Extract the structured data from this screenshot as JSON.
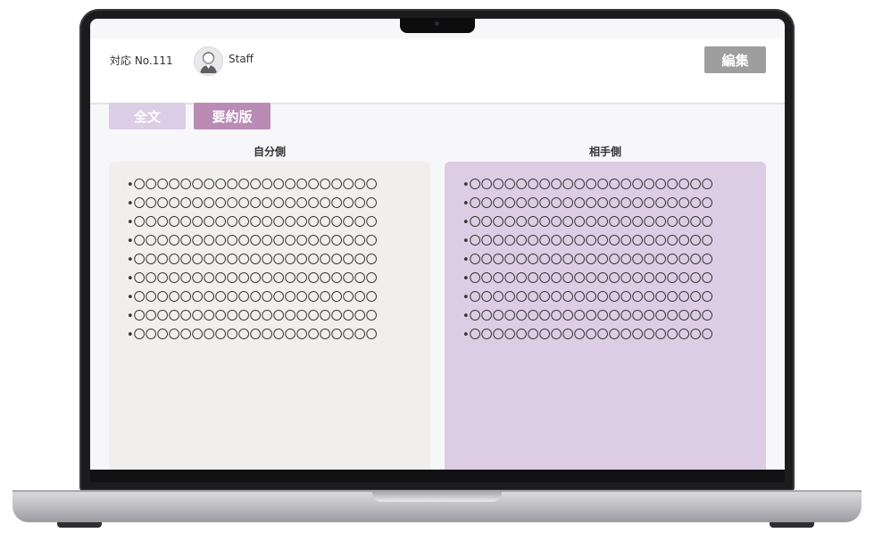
{
  "header": {
    "case_label": "対応 No.111",
    "staff_label": "Staff",
    "edit_label": "編集"
  },
  "tabs": [
    {
      "label": "全文",
      "active": false
    },
    {
      "label": "要約版",
      "active": true
    }
  ],
  "columns": {
    "self": {
      "title": "自分側",
      "items": [
        "•〇〇〇〇〇〇〇〇〇〇〇〇〇〇〇〇〇〇〇〇〇",
        "•〇〇〇〇〇〇〇〇〇〇〇〇〇〇〇〇〇〇〇〇〇",
        "•〇〇〇〇〇〇〇〇〇〇〇〇〇〇〇〇〇〇〇〇〇",
        "•〇〇〇〇〇〇〇〇〇〇〇〇〇〇〇〇〇〇〇〇〇",
        "•〇〇〇〇〇〇〇〇〇〇〇〇〇〇〇〇〇〇〇〇〇",
        "•〇〇〇〇〇〇〇〇〇〇〇〇〇〇〇〇〇〇〇〇〇",
        "•〇〇〇〇〇〇〇〇〇〇〇〇〇〇〇〇〇〇〇〇〇",
        "•〇〇〇〇〇〇〇〇〇〇〇〇〇〇〇〇〇〇〇〇〇",
        "•〇〇〇〇〇〇〇〇〇〇〇〇〇〇〇〇〇〇〇〇〇"
      ]
    },
    "other": {
      "title": "相手側",
      "items": [
        "•〇〇〇〇〇〇〇〇〇〇〇〇〇〇〇〇〇〇〇〇〇",
        "•〇〇〇〇〇〇〇〇〇〇〇〇〇〇〇〇〇〇〇〇〇",
        "•〇〇〇〇〇〇〇〇〇〇〇〇〇〇〇〇〇〇〇〇〇",
        "•〇〇〇〇〇〇〇〇〇〇〇〇〇〇〇〇〇〇〇〇〇",
        "•〇〇〇〇〇〇〇〇〇〇〇〇〇〇〇〇〇〇〇〇〇",
        "•〇〇〇〇〇〇〇〇〇〇〇〇〇〇〇〇〇〇〇〇〇",
        "•〇〇〇〇〇〇〇〇〇〇〇〇〇〇〇〇〇〇〇〇〇",
        "•〇〇〇〇〇〇〇〇〇〇〇〇〇〇〇〇〇〇〇〇〇",
        "•〇〇〇〇〇〇〇〇〇〇〇〇〇〇〇〇〇〇〇〇〇"
      ]
    }
  },
  "icons": {
    "avatar": "staff-avatar-icon"
  },
  "colors": {
    "edit_button": "#9e9e9e",
    "tab_inactive": "#dbcde6",
    "tab_active": "#b98bb5",
    "panel_self": "#f0efed",
    "panel_other": "#ddcde4"
  }
}
